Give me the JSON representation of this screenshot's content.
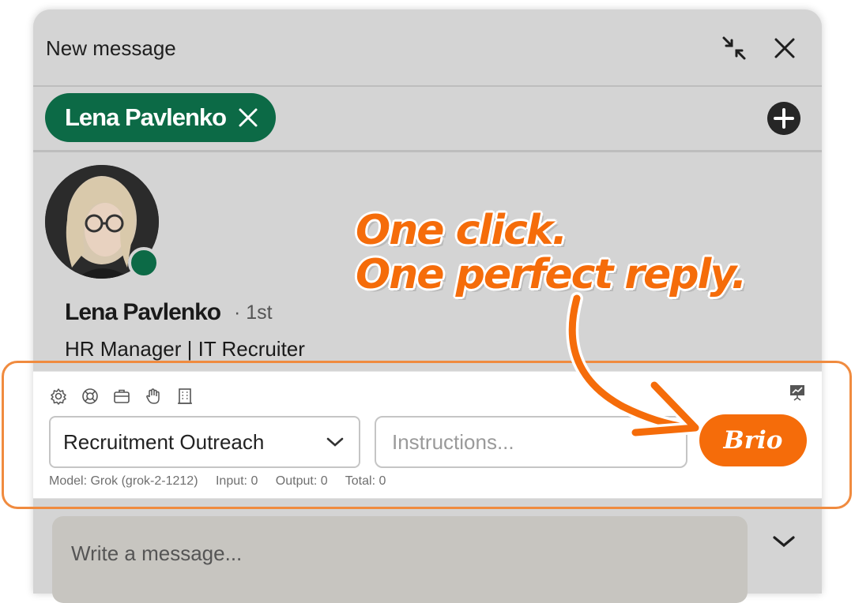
{
  "header": {
    "title": "New message"
  },
  "recipient": {
    "name": "Lena Pavlenko"
  },
  "profile": {
    "name": "Lena Pavlenko",
    "degree": "· 1st",
    "headline": "HR Manager | IT Recruiter",
    "status": "online"
  },
  "toolbar": {
    "icons": [
      "settings-icon",
      "lifebuoy-icon",
      "briefcase-icon",
      "hand-icon",
      "building-icon",
      "presentation-chart-icon"
    ],
    "template_select": "Recruitment Outreach",
    "instructions_placeholder": "Instructions...",
    "brio_label": "Brio",
    "stats": {
      "model": "Model: Grok (grok-2-1212)",
      "input": "Input: 0",
      "output": "Output: 0",
      "total": "Total: 0"
    }
  },
  "composer": {
    "placeholder": "Write a message..."
  },
  "callout": {
    "line1": "One click.",
    "line2": "One perfect reply."
  },
  "colors": {
    "brand_green": "#0c6a46",
    "accent_orange": "#f56c0a"
  }
}
